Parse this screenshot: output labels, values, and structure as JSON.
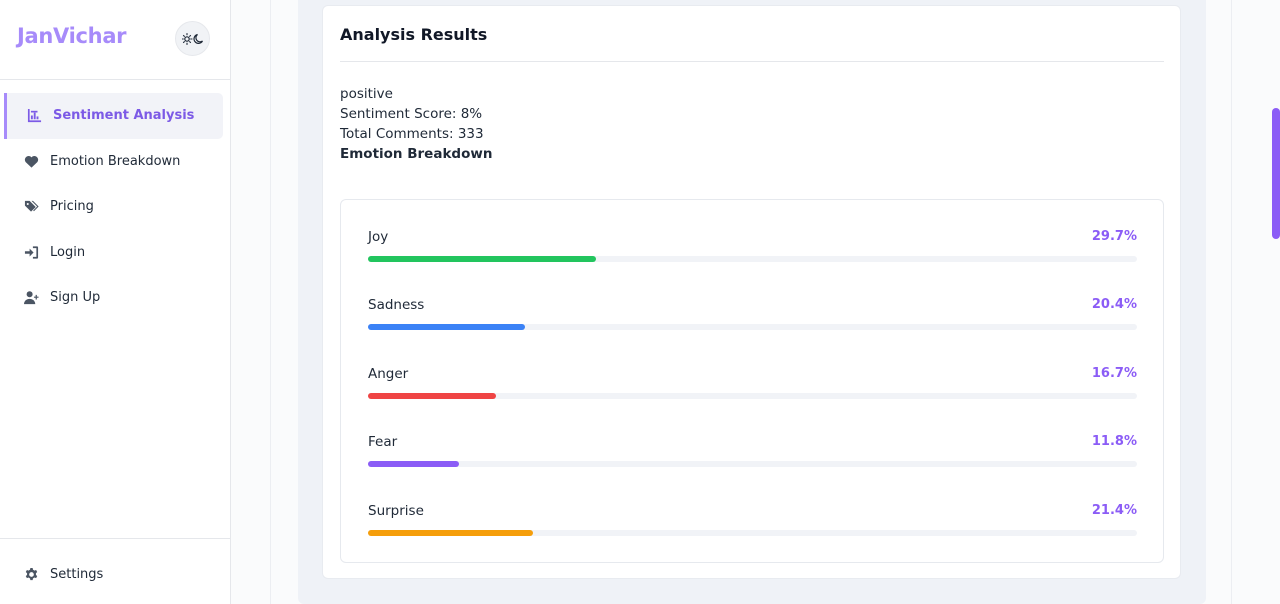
{
  "brand": {
    "name": "JanVichar"
  },
  "sidebar": {
    "items": [
      {
        "label": "Sentiment Analysis",
        "icon": "chart-bar-icon",
        "active": true
      },
      {
        "label": "Emotion Breakdown",
        "icon": "heart-icon",
        "active": false
      },
      {
        "label": "Pricing",
        "icon": "tags-icon",
        "active": false
      },
      {
        "label": "Login",
        "icon": "sign-in-icon",
        "active": false
      },
      {
        "label": "Sign Up",
        "icon": "user-plus-icon",
        "active": false
      }
    ],
    "settings": {
      "label": "Settings",
      "icon": "gear-icon"
    }
  },
  "results": {
    "title": "Analysis Results",
    "sentiment": "positive",
    "score_line": "Sentiment Score: 8%",
    "comments_line": "Total Comments: 333",
    "breakdown_heading": "Emotion Breakdown"
  },
  "emotions": [
    {
      "name": "Joy",
      "percent_label": "29.7%",
      "percent": 29.7,
      "color": "#22c55e"
    },
    {
      "name": "Sadness",
      "percent_label": "20.4%",
      "percent": 20.4,
      "color": "#3b82f6"
    },
    {
      "name": "Anger",
      "percent_label": "16.7%",
      "percent": 16.7,
      "color": "#ef4444"
    },
    {
      "name": "Fear",
      "percent_label": "11.8%",
      "percent": 11.8,
      "color": "#8b5cf6"
    },
    {
      "name": "Surprise",
      "percent_label": "21.4%",
      "percent": 21.4,
      "color": "#f59e0b"
    }
  ],
  "colors": {
    "accent": "#8b5cf6",
    "brand": "#a78bfa"
  }
}
